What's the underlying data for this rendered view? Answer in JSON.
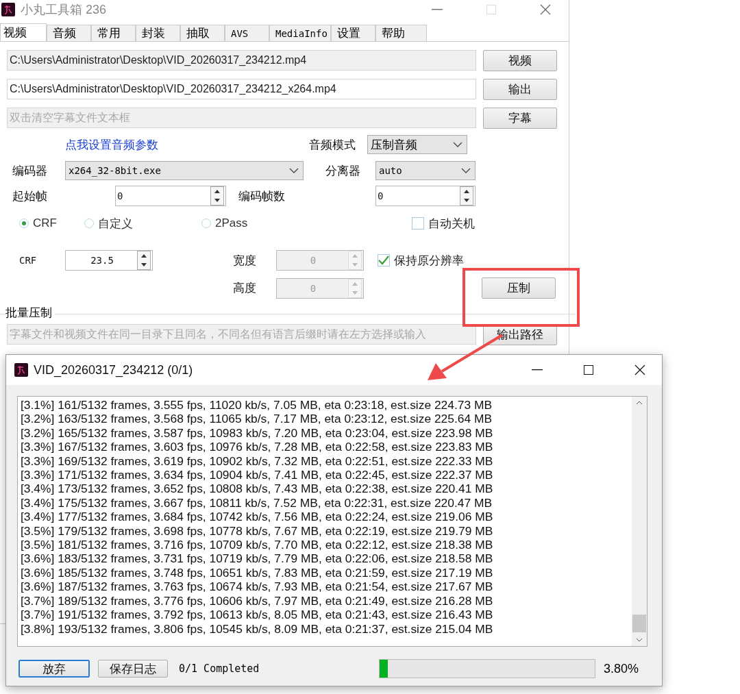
{
  "main_window": {
    "title": "小丸工具箱 236",
    "tabs": [
      {
        "label": "视频",
        "selected": true
      },
      {
        "label": "音频",
        "selected": false
      },
      {
        "label": "常用",
        "selected": false
      },
      {
        "label": "封装",
        "selected": false
      },
      {
        "label": "抽取",
        "selected": false
      },
      {
        "label": "AVS",
        "selected": false
      },
      {
        "label": "MediaInfo",
        "selected": false
      },
      {
        "label": "设置",
        "selected": false
      },
      {
        "label": "帮助",
        "selected": false
      }
    ],
    "file_rows": [
      {
        "value": "C:\\Users\\Administrator\\Desktop\\VID_20260317_234212.mp4",
        "button": "视频",
        "kind": "readonly"
      },
      {
        "value": "C:\\Users\\Administrator\\Desktop\\VID_20260317_234212_x264.mp4",
        "button": "输出",
        "kind": "editable"
      },
      {
        "placeholder": "双击清空字幕文件文本框",
        "button": "字幕",
        "kind": "readonly"
      }
    ],
    "audio_link": "点我设置音频参数",
    "audio_mode": {
      "label": "音频模式",
      "value": "压制音频"
    },
    "encoder": {
      "label": "编码器",
      "value": "x264_32-8bit.exe"
    },
    "demuxer": {
      "label": "分离器",
      "value": "auto"
    },
    "start_frame": {
      "label": "起始帧",
      "value": "0",
      "disabled": false
    },
    "frame_count": {
      "label": "编码帧数",
      "value": "0",
      "disabled": false
    },
    "rate_modes": [
      {
        "label": "CRF",
        "selected": true
      },
      {
        "label": "自定义",
        "selected": false
      },
      {
        "label": "2Pass",
        "selected": false
      }
    ],
    "auto_shutdown": {
      "label": "自动关机",
      "checked": false
    },
    "crf": {
      "label": "CRF",
      "value": "23.5",
      "disabled": false
    },
    "width": {
      "label": "宽度",
      "value": "0",
      "disabled": true
    },
    "height": {
      "label": "高度",
      "value": "0",
      "disabled": true
    },
    "keep_resolution": {
      "label": "保持原分辨率",
      "checked": true
    },
    "encode_button": "压制",
    "batch": {
      "title": "批量压制",
      "placeholder": "字幕文件和视频文件在同一目录下且同名，不同名但有语言后缀时请在左方选择或输入",
      "button": "输出路径"
    }
  },
  "dialog": {
    "title": "VID_20260317_234212 (0/1)",
    "log": [
      "[3.1%] 161/5132 frames, 3.555 fps, 11020 kb/s, 7.05 MB, eta 0:23:18, est.size 224.73 MB",
      "[3.2%] 163/5132 frames, 3.568 fps, 11065 kb/s, 7.17 MB, eta 0:23:12, est.size 225.64 MB",
      "[3.2%] 165/5132 frames, 3.587 fps, 10983 kb/s, 7.20 MB, eta 0:23:04, est.size 223.98 MB",
      "[3.3%] 167/5132 frames, 3.603 fps, 10976 kb/s, 7.28 MB, eta 0:22:58, est.size 223.83 MB",
      "[3.3%] 169/5132 frames, 3.619 fps, 10902 kb/s, 7.32 MB, eta 0:22:51, est.size 222.33 MB",
      "[3.3%] 171/5132 frames, 3.634 fps, 10904 kb/s, 7.41 MB, eta 0:22:45, est.size 222.37 MB",
      "[3.4%] 173/5132 frames, 3.652 fps, 10808 kb/s, 7.43 MB, eta 0:22:38, est.size 220.41 MB",
      "[3.4%] 175/5132 frames, 3.667 fps, 10811 kb/s, 7.52 MB, eta 0:22:31, est.size 220.47 MB",
      "[3.4%] 177/5132 frames, 3.684 fps, 10742 kb/s, 7.56 MB, eta 0:22:24, est.size 219.06 MB",
      "[3.5%] 179/5132 frames, 3.698 fps, 10778 kb/s, 7.67 MB, eta 0:22:19, est.size 219.79 MB",
      "[3.5%] 181/5132 frames, 3.716 fps, 10709 kb/s, 7.70 MB, eta 0:22:12, est.size 218.38 MB",
      "[3.6%] 183/5132 frames, 3.731 fps, 10719 kb/s, 7.79 MB, eta 0:22:06, est.size 218.58 MB",
      "[3.6%] 185/5132 frames, 3.748 fps, 10651 kb/s, 7.83 MB, eta 0:21:59, est.size 217.19 MB",
      "[3.6%] 187/5132 frames, 3.763 fps, 10674 kb/s, 7.93 MB, eta 0:21:54, est.size 217.67 MB",
      "[3.7%] 189/5132 frames, 3.776 fps, 10606 kb/s, 7.97 MB, eta 0:21:49, est.size 216.28 MB",
      "[3.7%] 191/5132 frames, 3.792 fps, 10613 kb/s, 8.05 MB, eta 0:21:43, est.size 216.43 MB",
      "[3.8%] 193/5132 frames, 3.806 fps, 10545 kb/s, 8.09 MB, eta 0:21:37, est.size 215.04 MB"
    ],
    "buttons": [
      {
        "label": "放弃",
        "focused": true
      },
      {
        "label": "保存日志",
        "focused": false
      }
    ],
    "status": "0/1 Completed",
    "progress": {
      "level": 0.038,
      "reading": "3.80%"
    }
  }
}
